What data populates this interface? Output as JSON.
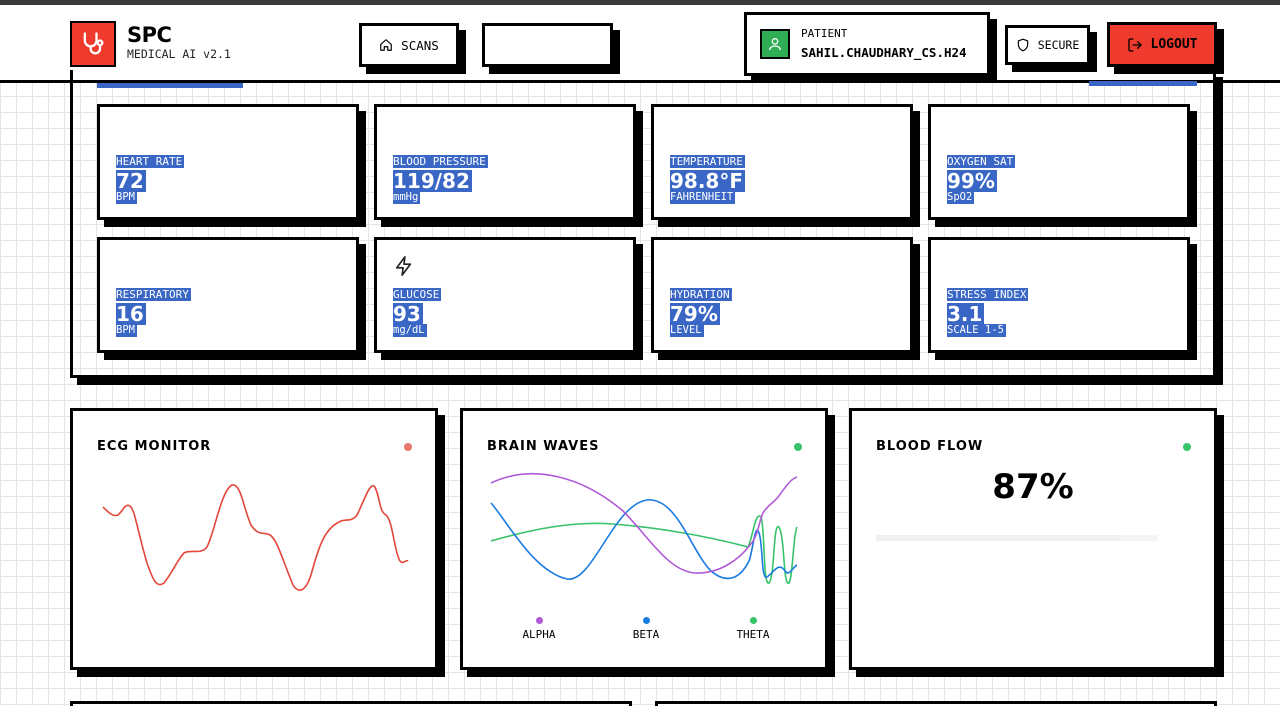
{
  "header": {
    "brand_name": "SPC",
    "brand_sub": "MEDICAL AI v2.1",
    "nav_scans": "SCANS",
    "nav_blank": "",
    "patient_label": "PATIENT",
    "patient_name": "SAHIL.CHAUDHARY_CS.H24",
    "secure_label": "SECURE",
    "logout_label": "LOGOUT"
  },
  "colors": {
    "accent_red": "#ef3b2d",
    "patient_green": "#2fae55",
    "selection_blue": "#3a67c6",
    "ecg_line": "#e2473a",
    "alpha": "#b05ad6",
    "beta": "#1a7ae0",
    "theta": "#38c26a"
  },
  "vitals": [
    {
      "label": "HEART RATE",
      "value": "72",
      "unit": "BPM"
    },
    {
      "label": "BLOOD PRESSURE",
      "value": "119/82",
      "unit": "mmHg"
    },
    {
      "label": "TEMPERATURE",
      "value": "98.8°F",
      "unit": "FAHRENHEIT"
    },
    {
      "label": "OXYGEN SAT",
      "value": "99%",
      "unit": "SpO2"
    },
    {
      "label": "RESPIRATORY",
      "value": "16",
      "unit": "BPM"
    },
    {
      "label": "GLUCOSE",
      "value": "93",
      "unit": "mg/dL",
      "icon": "lightning-icon"
    },
    {
      "label": "HYDRATION",
      "value": "79%",
      "unit": "LEVEL"
    },
    {
      "label": "STRESS INDEX",
      "value": "3.1",
      "unit": "SCALE 1-5"
    }
  ],
  "charts": {
    "ecg": {
      "title": "ECG MONITOR",
      "status_color": "#e8766d"
    },
    "brain": {
      "title": "BRAIN WAVES",
      "status_color": "#38c26a",
      "legend": [
        "ALPHA",
        "BETA",
        "THETA"
      ]
    },
    "blood_flow": {
      "title": "BLOOD FLOW",
      "value": "87%",
      "fraction": 0.87,
      "status_color": "#38c26a"
    }
  },
  "icons": {
    "logo": "stethoscope-icon",
    "scans": "home-icon",
    "patient": "user-icon",
    "secure": "shield-icon",
    "logout": "logout-icon"
  }
}
